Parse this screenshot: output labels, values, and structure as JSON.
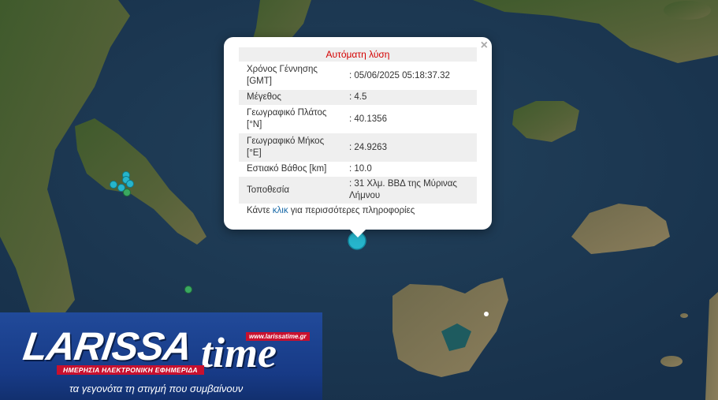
{
  "popup": {
    "title": "Αυτόματη λύση",
    "close": "×",
    "rows": [
      {
        "label": "Χρόνος Γέννησης [GMT]",
        "value": ": 05/06/2025 05:18:37.32"
      },
      {
        "label": "Μέγεθος",
        "value": ": 4.5"
      },
      {
        "label": "Γεωγραφικό Πλάτος [°N]",
        "value": ": 40.1356"
      },
      {
        "label": "Γεωγραφικό Μήκος [°E]",
        "value": ": 24.9263"
      },
      {
        "label": "Εστιακό Βάθος [km]",
        "value": ": 10.0"
      },
      {
        "label": "Τοποθεσία",
        "value": ": 31 Χλμ. ΒΒΔ της Μύρινας Λήμνου"
      }
    ],
    "more_prefix": "Κάντε ",
    "more_link": "κλικ",
    "more_suffix": " για περισσότερες πληροφορίες"
  },
  "map": {
    "sea_color": "#1e3a52",
    "land_color": "#4a5a32",
    "quake_color": "#26b5cc",
    "older_quake_color": "#3aa860"
  },
  "logo": {
    "word": "LARISSA",
    "time": "time",
    "url": "www.larissatime.gr",
    "band": "ΗΜΕΡΗΣΙΑ ΗΛΕΚΤΡΟΝΙΚΗ ΕΦΗΜΕΡΙΔΑ",
    "slogan": "τα γεγονότα τη στιγμή που συμβαίνουν"
  }
}
